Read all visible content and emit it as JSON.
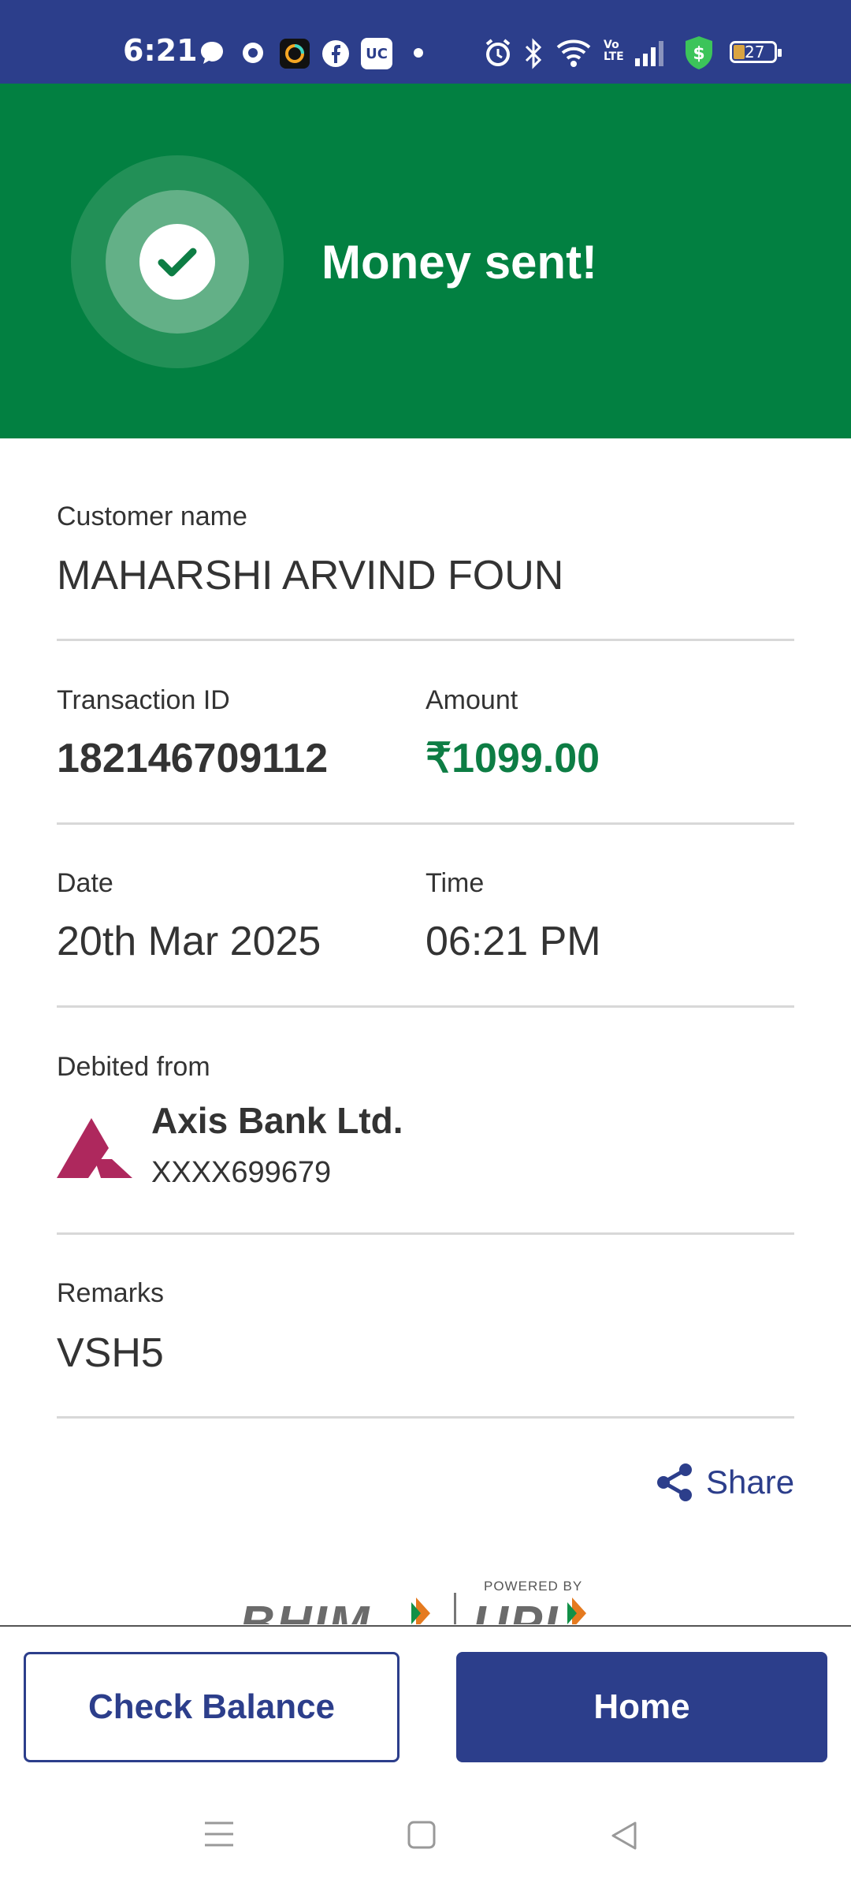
{
  "status_bar": {
    "time": "6:21",
    "battery": "27",
    "icons": [
      "chat-icon",
      "messenger-icon",
      "app-icon",
      "facebook-icon",
      "uc-browser-icon",
      "dot-icon",
      "alarm-icon",
      "bluetooth-icon",
      "wifi-icon",
      "volte-icon",
      "signal-icon",
      "shield-dollar-icon",
      "battery-icon"
    ],
    "icon_uc": "UC",
    "icon_volte": "Vo LTE"
  },
  "header": {
    "title": "Money sent!",
    "color": "#028041"
  },
  "details": {
    "customer_label": "Customer name",
    "customer_value": "MAHARSHI ARVIND FOUN",
    "txn_label": "Transaction ID",
    "txn_value": "182146709112",
    "amount_label": "Amount",
    "amount_value": "₹1099.00",
    "date_label": "Date",
    "date_value": "20th Mar 2025",
    "time_label": "Time",
    "time_value": "06:21 PM",
    "debited_label": "Debited from",
    "bank_name": "Axis Bank Ltd.",
    "bank_account": "XXXX699679",
    "remarks_label": "Remarks",
    "remarks_value": "VSH5"
  },
  "share_label": "Share",
  "upi_logo": {
    "powered_by": "POWERED BY",
    "bhim": "BHIM",
    "upi": "UPI"
  },
  "buttons": {
    "check_balance": "Check Balance",
    "home": "Home"
  },
  "colors": {
    "primary": "#2c3e8b",
    "success": "#028041",
    "amount": "#0d7d44",
    "axis_logo": "#ae285d"
  }
}
